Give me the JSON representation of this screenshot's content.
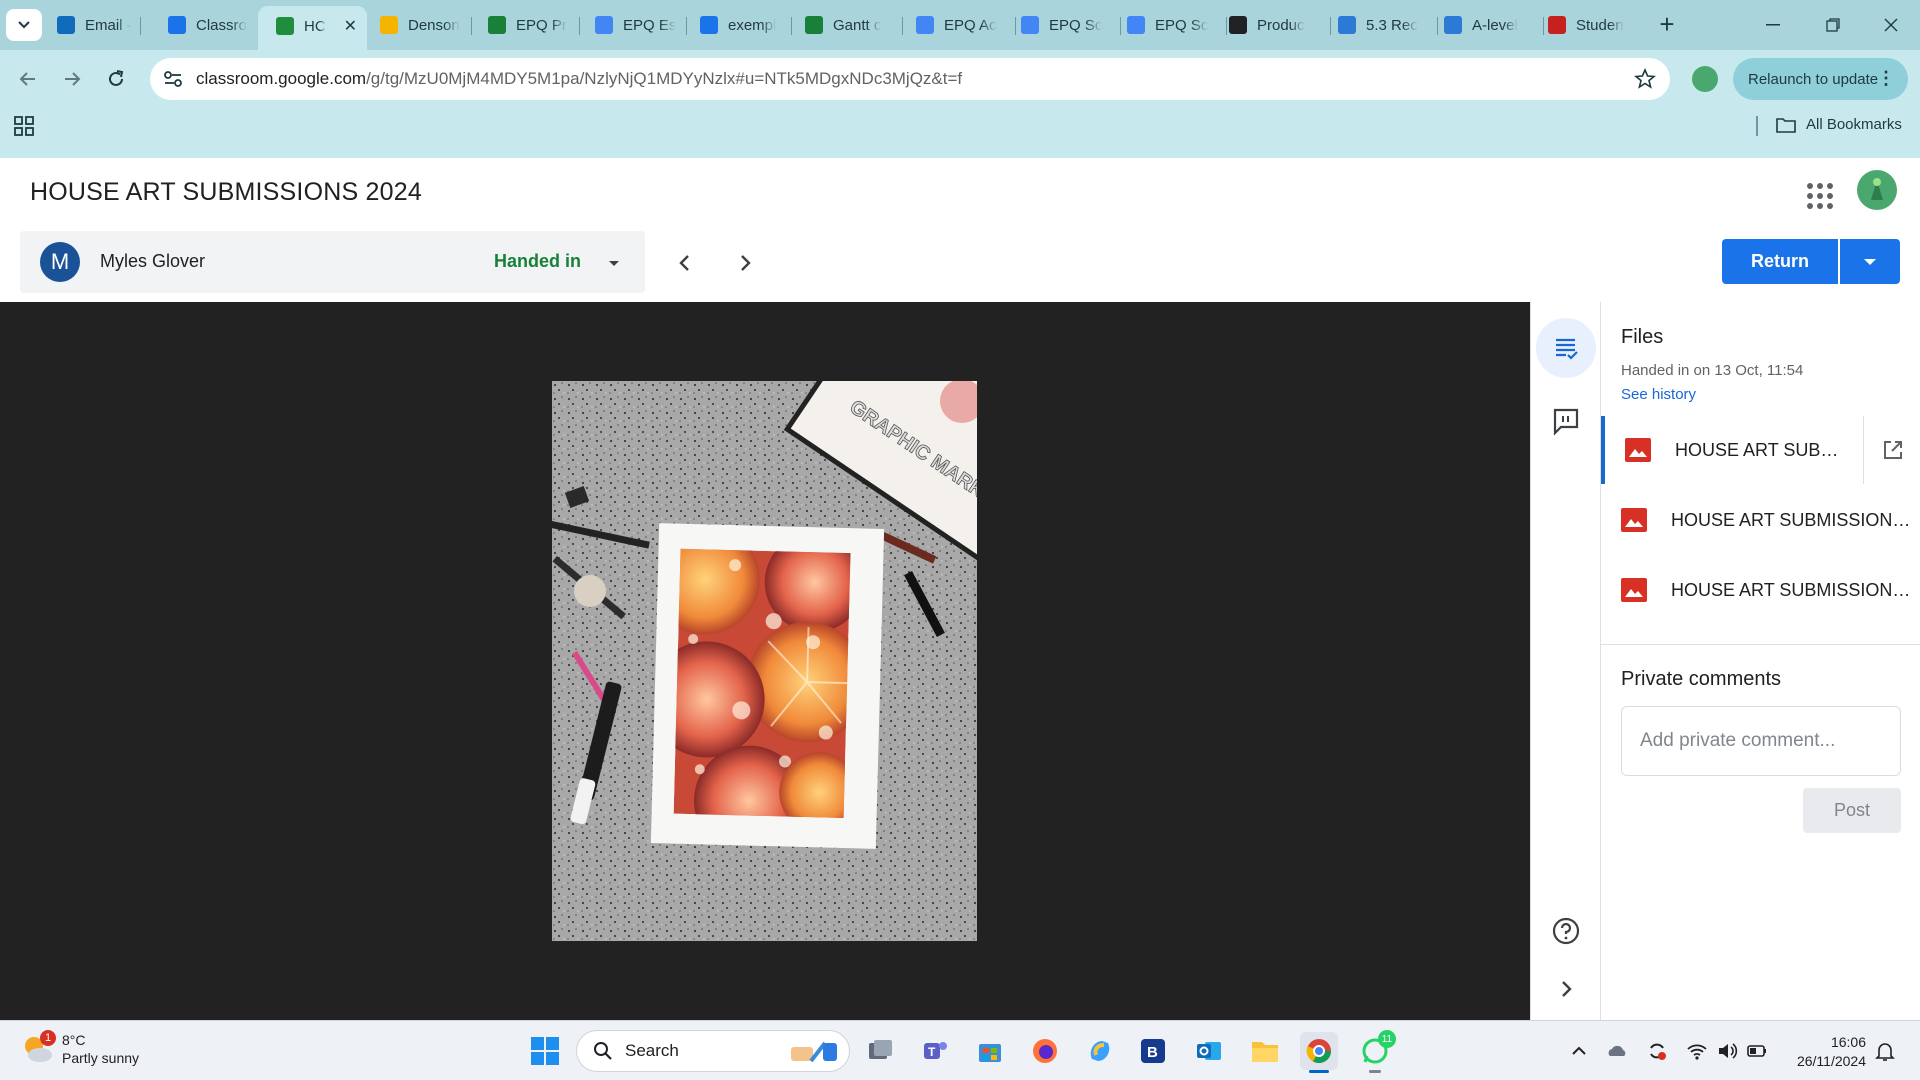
{
  "browser": {
    "tabs": [
      {
        "title": "Email -",
        "icon": "outlook-icon",
        "color": "#0f6cbd"
      },
      {
        "title": "Classro",
        "icon": "classroom-people-icon",
        "color": "#1a73e8"
      },
      {
        "title": "HC",
        "icon": "classroom-icon",
        "color": "#1e8e3e",
        "active": true
      },
      {
        "title": "Denson",
        "icon": "slides-icon",
        "color": "#f4b400"
      },
      {
        "title": "EPQ Pr",
        "icon": "sheets-icon",
        "color": "#188038"
      },
      {
        "title": "EPQ Es",
        "icon": "docs-icon",
        "color": "#4285f4"
      },
      {
        "title": "exempl",
        "icon": "pinterest-like-icon",
        "color": "#1a73e8"
      },
      {
        "title": "Gantt c",
        "icon": "sheets-icon",
        "color": "#188038"
      },
      {
        "title": "EPQ Ac",
        "icon": "docs-icon",
        "color": "#4285f4"
      },
      {
        "title": "EPQ Sc",
        "icon": "docs-icon",
        "color": "#4285f4"
      },
      {
        "title": "EPQ Sc",
        "icon": "docs-icon",
        "color": "#4285f4"
      },
      {
        "title": "Produc",
        "icon": "search-q-icon",
        "color": "#202124"
      },
      {
        "title": "5.3 Rec",
        "icon": "w-logo-icon",
        "color": "#2b7bd6"
      },
      {
        "title": "A-level",
        "icon": "w-logo-icon",
        "color": "#2b7bd6"
      },
      {
        "title": "Studen",
        "icon": "red-grid-icon",
        "color": "#c5221f"
      }
    ],
    "url_main": "classroom.google.com",
    "url_rest": "/g/tg/MzU0MjM4MDY5M1pa/NzlyNjQ1MDYyNzlx#u=NTk5MDgxNDc3MjQz&t=f",
    "relaunch_label": "Relaunch to update",
    "bookmarks_label": "All Bookmarks"
  },
  "classroom": {
    "title": "HOUSE ART SUBMISSIONS 2024",
    "student_initial": "M",
    "student_name": "Myles Glover",
    "status": "Handed in",
    "return_label": "Return",
    "files_heading": "Files",
    "handed_in_date": "Handed in on 13 Oct, 11:54",
    "see_history": "See history",
    "files": [
      {
        "name": "HOUSE ART SUBMIS...",
        "selected": true
      },
      {
        "name": "HOUSE ART SUBMISSIONS 2..."
      },
      {
        "name": "HOUSE ART SUBMISSIONS 2..."
      }
    ],
    "private_comments_heading": "Private comments",
    "comment_placeholder": "Add private comment...",
    "post_label": "Post"
  },
  "artwork": {
    "lettering": "GRAPHIC MARKER"
  },
  "taskbar": {
    "weather_temp": "8°C",
    "weather_desc": "Partly sunny",
    "weather_badge": "1",
    "search_label": "Search",
    "whatsapp_badge": "11",
    "time": "16:06",
    "date": "26/11/2024"
  },
  "colors": {
    "accent": "#1a73e8",
    "status_green": "#188038",
    "chrome_frame": "#a9d4dc",
    "viewer_bg": "#222222"
  }
}
